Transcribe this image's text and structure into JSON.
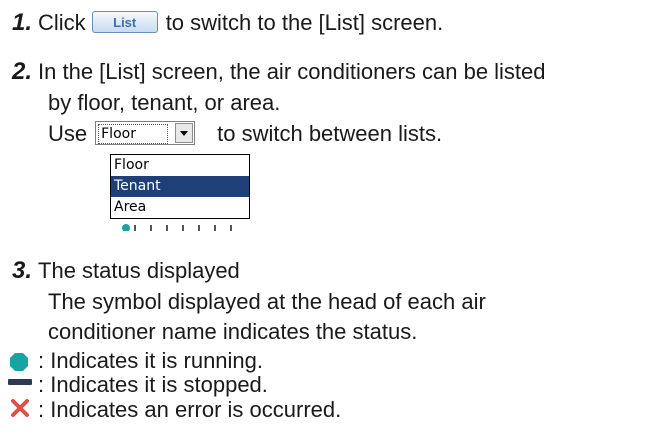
{
  "step1": {
    "number": "1.",
    "pre_text": "Click",
    "button_label": "List",
    "post_text": "to switch to the [List] screen."
  },
  "step2": {
    "number": "2.",
    "line1": "In the [List] screen, the air conditioners can be listed",
    "line2": "by floor, tenant, or area.",
    "use_pre": "Use",
    "select_value": "Floor",
    "use_post": "to switch between lists.",
    "options": [
      "Floor",
      "Tenant",
      "Area"
    ],
    "selected_option": "Tenant"
  },
  "step3": {
    "number": "3.",
    "line1": "The status displayed",
    "line2": "The symbol displayed at the head of each air",
    "line3": "conditioner name indicates the status."
  },
  "legend": {
    "running": ": Indicates it is running.",
    "stopped": ": Indicates it is stopped.",
    "error": ": Indicates an error is occurred."
  },
  "colors": {
    "running": "#1aa3a3",
    "stopped": "#2c3b52",
    "error": "#e0504a",
    "selected_option_bg": "#1e3f78"
  }
}
